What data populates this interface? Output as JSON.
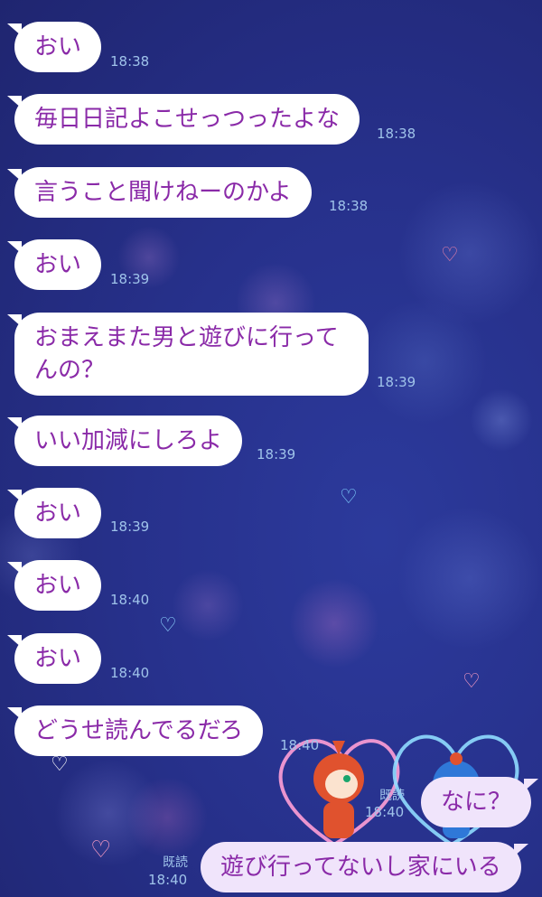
{
  "theme": {
    "background": "#27318c",
    "bubble_color": "#ffffff",
    "bubble_text": "#8a2aa8",
    "sent_bubble": "#f0e4fb",
    "time_color": "#9fc3ea"
  },
  "messages": [
    {
      "text": "おい",
      "time": "18:38",
      "side": "left"
    },
    {
      "text": "毎日日記よこせっつったよな",
      "time": "18:38",
      "side": "left"
    },
    {
      "text": "言うこと聞けねーのかよ",
      "time": "18:38",
      "side": "left"
    },
    {
      "text": "おい",
      "time": "18:39",
      "side": "left"
    },
    {
      "text": "おまえまた男と遊びに行ってんの？",
      "time": "18:39",
      "side": "left"
    },
    {
      "text": "いい加減にしろよ",
      "time": "18:39",
      "side": "left"
    },
    {
      "text": "おい",
      "time": "18:39",
      "side": "left"
    },
    {
      "text": "おい",
      "time": "18:40",
      "side": "left"
    },
    {
      "text": "おい",
      "time": "18:40",
      "side": "left"
    },
    {
      "text": "どうせ読んでるだろ",
      "time": "18:40",
      "side": "left"
    },
    {
      "text": "なに？",
      "time": "18:40",
      "side": "right",
      "read": "既読"
    },
    {
      "text": "遊び行ってないし家にいる",
      "time": "18:40",
      "side": "right",
      "read": "既読"
    }
  ],
  "message5_lines": [
    "おまえまた男と遊びに行って",
    "んの？"
  ],
  "sticker": {
    "icon": "heart-couple-sticker"
  }
}
